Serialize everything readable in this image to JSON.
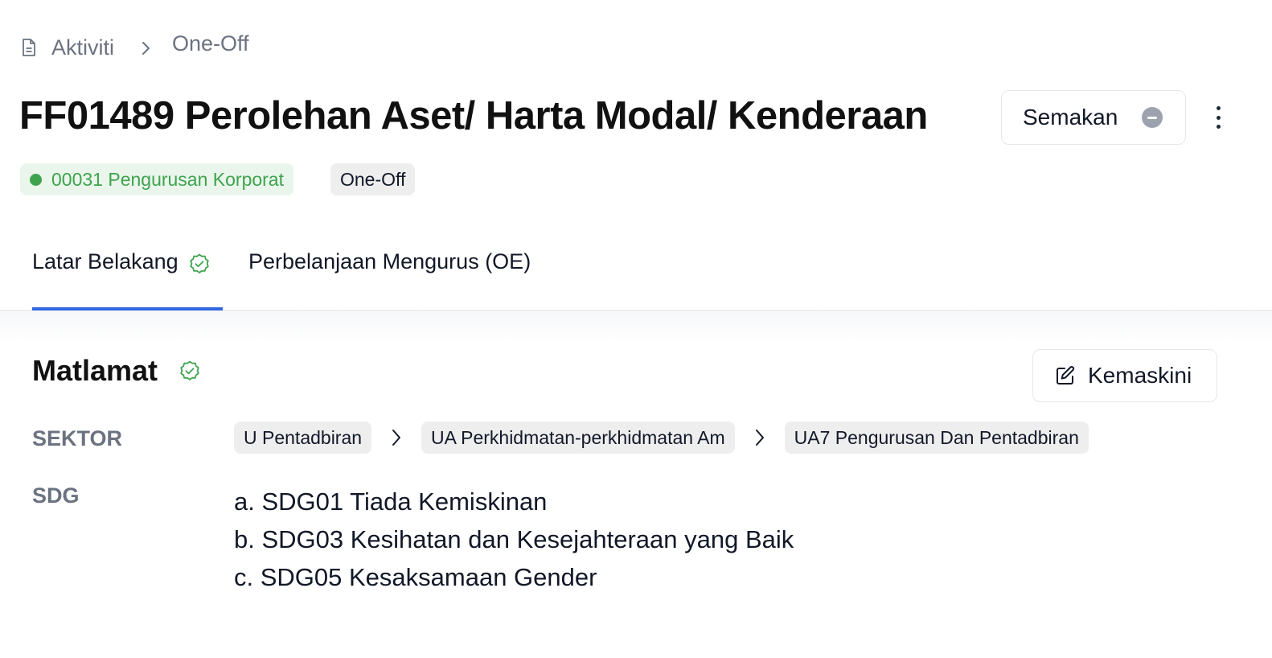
{
  "breadcrumb": {
    "icon": "document-icon",
    "items": [
      "Aktiviti",
      "One-Off"
    ]
  },
  "header": {
    "title": "FF01489 Perolehan Aset/ Harta Modal/ Kenderaan",
    "review_button": {
      "label": "Semakan",
      "icon": "minus-circle-icon"
    },
    "more_icon": "more-vertical-icon"
  },
  "badges": {
    "organization": "00031 Pengurusan Korporat",
    "type": "One-Off"
  },
  "tabs": [
    {
      "label": "Latar Belakang",
      "active": true,
      "status_icon": "verified-check-icon"
    },
    {
      "label": "Perbelanjaan Mengurus (OE)",
      "active": false
    }
  ],
  "section": {
    "title": "Matlamat",
    "status_icon": "verified-check-icon",
    "edit_button": {
      "label": "Kemaskini",
      "icon": "edit-icon"
    },
    "sektor": {
      "label": "SEKTOR",
      "chips": [
        "U Pentadbiran",
        "UA Perkhidmatan-perkhidmatan Am",
        "UA7 Pengurusan Dan Pentadbiran"
      ]
    },
    "sdg": {
      "label": "SDG",
      "items": [
        "a. SDG01 Tiada Kemiskinan",
        "b. SDG03 Kesihatan dan Kesejahteraan yang Baik",
        "c. SDG05 Kesaksamaan Gender"
      ]
    }
  },
  "colors": {
    "accent_blue": "#3367e0",
    "success_green": "#3fa34d",
    "muted_gray": "#6b7280"
  }
}
